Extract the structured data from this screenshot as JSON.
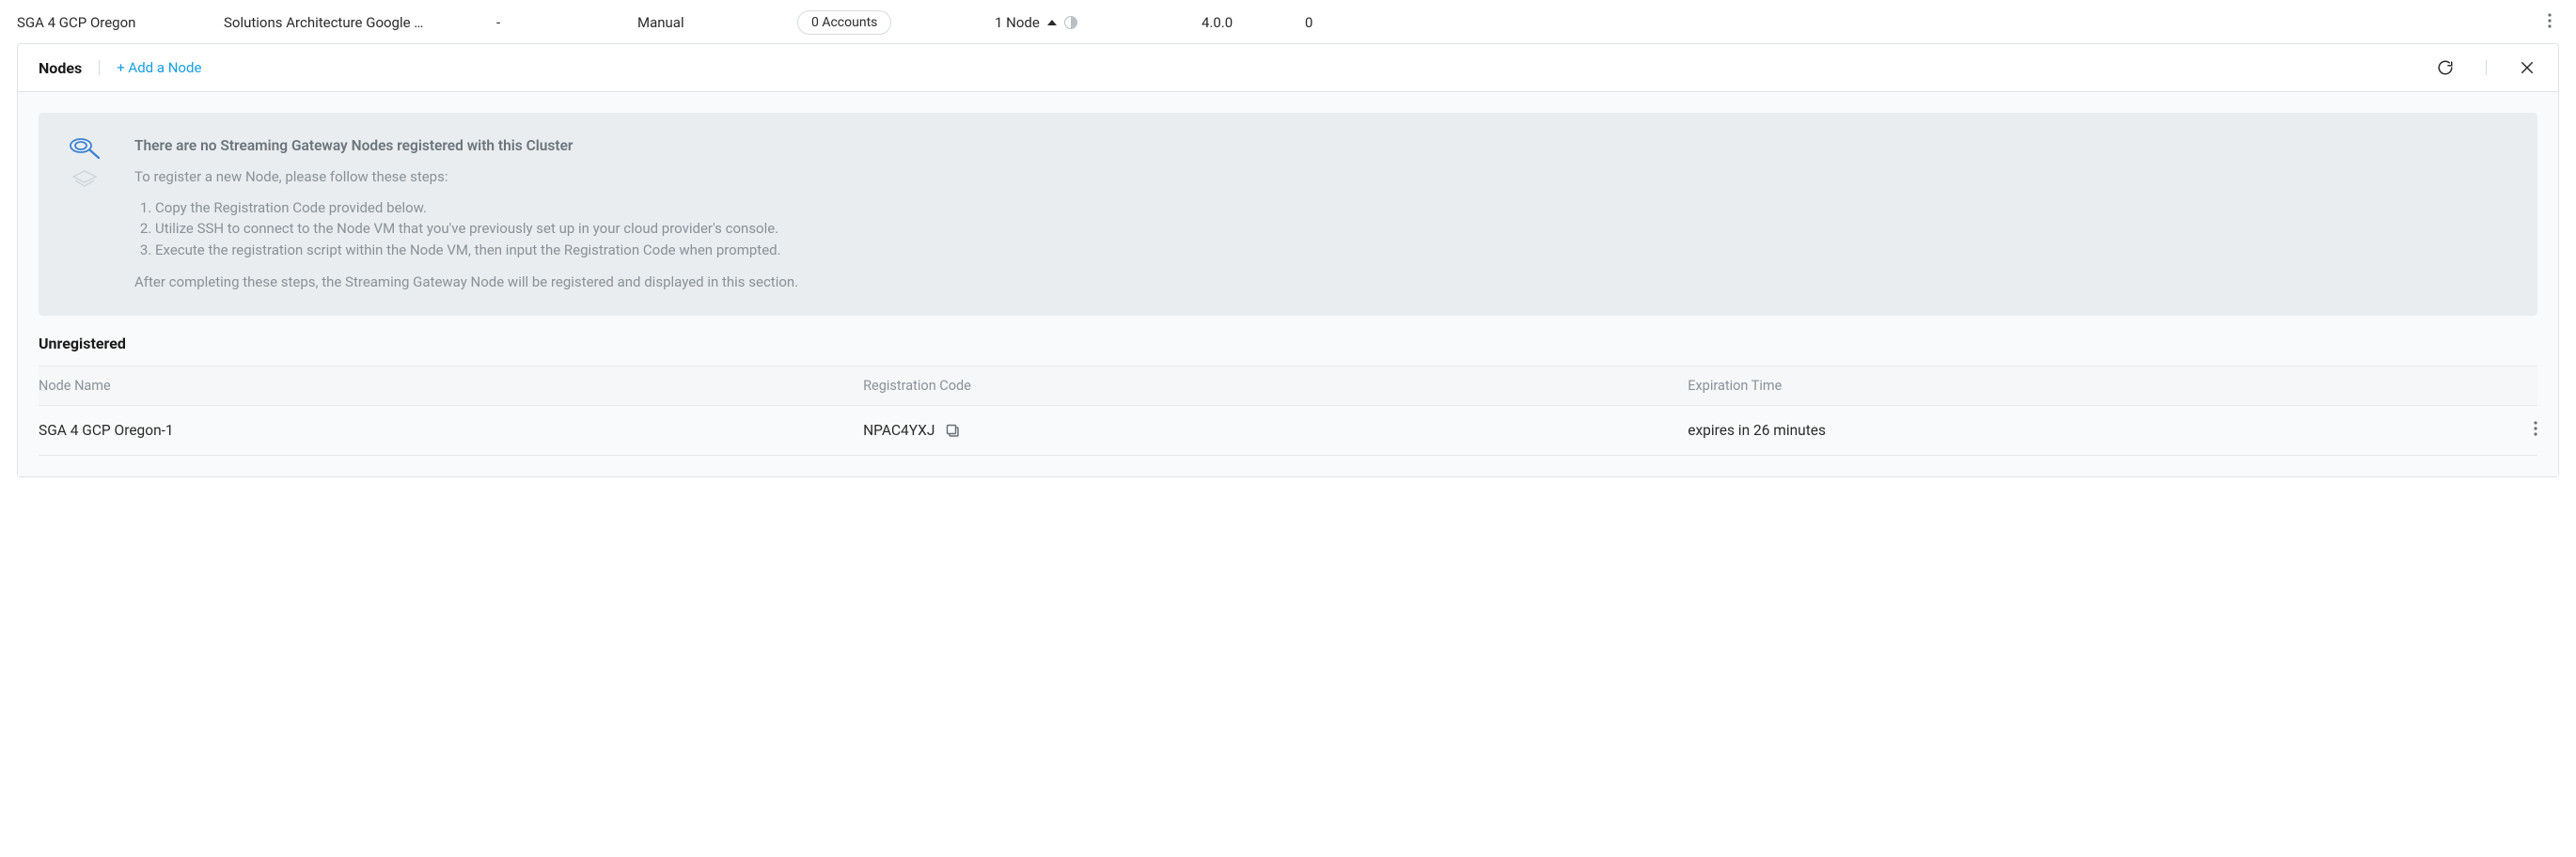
{
  "topRow": {
    "name": "SGA 4 GCP Oregon",
    "architecture": "Solutions Architecture Google …",
    "dash": "-",
    "mode": "Manual",
    "accounts": "0 Accounts",
    "node": "1 Node",
    "version": "4.0.0",
    "zero": "0"
  },
  "header": {
    "title": "Nodes",
    "addLink": "+ Add a Node"
  },
  "info": {
    "title": "There are no Streaming Gateway Nodes registered with this Cluster",
    "subtitle": "To register a new Node, please follow these steps:",
    "steps": [
      "Copy the Registration Code provided below.",
      "Utilize SSH to connect to the Node VM that you've previously set up in your cloud provider's console.",
      "Execute the registration script within the Node VM, then input the Registration Code when prompted."
    ],
    "footer": "After completing these steps, the Streaming Gateway Node will be registered and displayed in this section."
  },
  "section": "Unregistered",
  "tableHeaders": {
    "name": "Node Name",
    "code": "Registration Code",
    "exp": "Expiration Time"
  },
  "rows": [
    {
      "name": "SGA 4 GCP Oregon-1",
      "code": "NPAC4YXJ",
      "exp": "expires in 26 minutes"
    }
  ]
}
